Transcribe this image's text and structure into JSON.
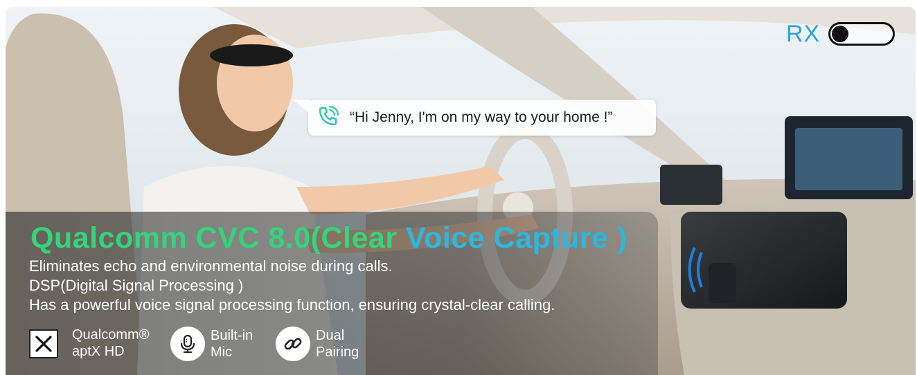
{
  "toggle": {
    "label": "RX",
    "state": "off",
    "accent_color": "#2aa3e6"
  },
  "bubble": {
    "icon": "phone-call-icon",
    "text": "“Hi Jenny, I'm on my way to your home !”"
  },
  "headline": {
    "part1": "Qualcomm CVC 8.0(Clear ",
    "part2": "Voice Capture )",
    "color_start": "#34d47a",
    "color_end": "#2bb7e0"
  },
  "description": [
    "Eliminates echo and environmental noise during calls.",
    "DSP(Digital Signal Processing )",
    "Has a powerful voice signal processing function, ensuring crystal-clear calling."
  ],
  "features": [
    {
      "icon": "aptx-hd-icon",
      "line1": "Qualcomm®",
      "line2": "aptX  HD"
    },
    {
      "icon": "microphone-icon",
      "line1": "Built-in",
      "line2": "Mic"
    },
    {
      "icon": "link-icon",
      "line1": "Dual",
      "line2": "Pairing"
    }
  ]
}
